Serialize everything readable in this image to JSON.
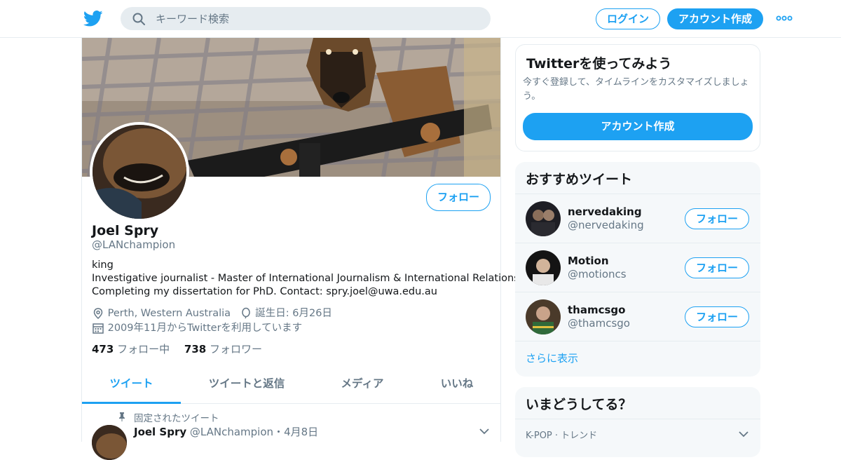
{
  "header": {
    "search_placeholder": "キーワード検索",
    "login_label": "ログイン",
    "signup_label": "アカウント作成"
  },
  "profile": {
    "follow_label": "フォロー",
    "name": "Joel Spry",
    "handle": "@LANchampion",
    "bio_lines": [
      "king",
      "Investigative journalist - Master of International Journalism & International Relations.",
      "Completing my dissertation for PhD. Contact: spry.joel@uwa.edu.au"
    ],
    "location": "Perth, Western Australia",
    "birthday": "誕生日: 6月26日",
    "joined": "2009年11月からTwitterを利用しています",
    "following_count": "473",
    "following_label": "フォロー中",
    "followers_count": "738",
    "followers_label": "フォロワー"
  },
  "tabs": [
    {
      "label": "ツイート",
      "active": true
    },
    {
      "label": "ツイートと返信",
      "active": false
    },
    {
      "label": "メディア",
      "active": false
    },
    {
      "label": "いいね",
      "active": false
    }
  ],
  "pinned_tweet": {
    "pinned_label": "固定されたツイート",
    "author_name": "Joel Spry",
    "author_handle": "@LANchampion",
    "separator": "・",
    "date": "4月8日"
  },
  "signup_card": {
    "title": "Twitterを使ってみよう",
    "description": "今すぐ登録して、タイムラインをカスタマイズしましょう。",
    "button_label": "アカウント作成"
  },
  "recommended": {
    "title": "おすすめツイート",
    "accounts": [
      {
        "name": "nervedaking",
        "handle": "@nervedaking",
        "follow_label": "フォロー"
      },
      {
        "name": "Motion",
        "handle": "@motioncs",
        "follow_label": "フォロー"
      },
      {
        "name": "thamcsgo",
        "handle": "@thamcsgo",
        "follow_label": "フォロー"
      }
    ],
    "more_label": "さらに表示"
  },
  "trends": {
    "title": "いまどうしてる？",
    "first_row": "K-POP · トレンド"
  },
  "colors": {
    "accent": "#1da1f2",
    "secondary_text": "#657786",
    "panel_bg": "#f5f8fa",
    "border": "#e6ecf0"
  }
}
